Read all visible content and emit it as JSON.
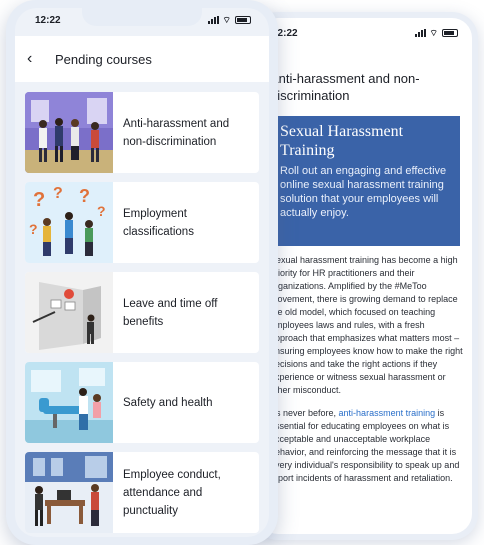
{
  "back_screen": {
    "status_time": "12:22",
    "title": "Anti-harassment and non-discrimination",
    "hero_title": "Sexual Harassment Training",
    "hero_subtitle": "Roll out an engaging and effective online sexual harassment training solution that your employees will actually enjoy.",
    "paragraph1": "Sexual harassment training has become a high priority for HR practitioners and their organizations. Amplified by the #MeToo movement, there is growing demand to replace the old model, which focused on teaching employees laws and rules, with a fresh approach that emphasizes what matters most – ensuring employees know how to make the right decisions and take the right actions if they experience or witness sexual harassment or other misconduct.",
    "paragraph2_prefix": "As never before, ",
    "paragraph2_link": "anti-harassment training",
    "paragraph2_suffix": " is essential for educating employees on what is acceptable and unacceptable workplace behavior, and reinforcing the message that it is every individual's responsibility to speak up and report incidents of harassment and retaliation.",
    "link_color": "#2a6fc9",
    "hero_color": "#3a63a8"
  },
  "front_screen": {
    "status_time": "12:22",
    "header_title": "Pending courses",
    "back_icon": "chevron-left-icon",
    "courses": [
      {
        "label": "Anti-harassment and non-discrimination",
        "thumb": "office-team-illustration"
      },
      {
        "label": "Employment classifications",
        "thumb": "question-marks-illustration"
      },
      {
        "label": "Leave and time off benefits",
        "thumb": "calendar-leave-illustration"
      },
      {
        "label": "Safety and health",
        "thumb": "dental-clinic-illustration"
      },
      {
        "label": "Employee conduct, attendance and punctuality",
        "thumb": "office-desk-illustration"
      }
    ]
  }
}
